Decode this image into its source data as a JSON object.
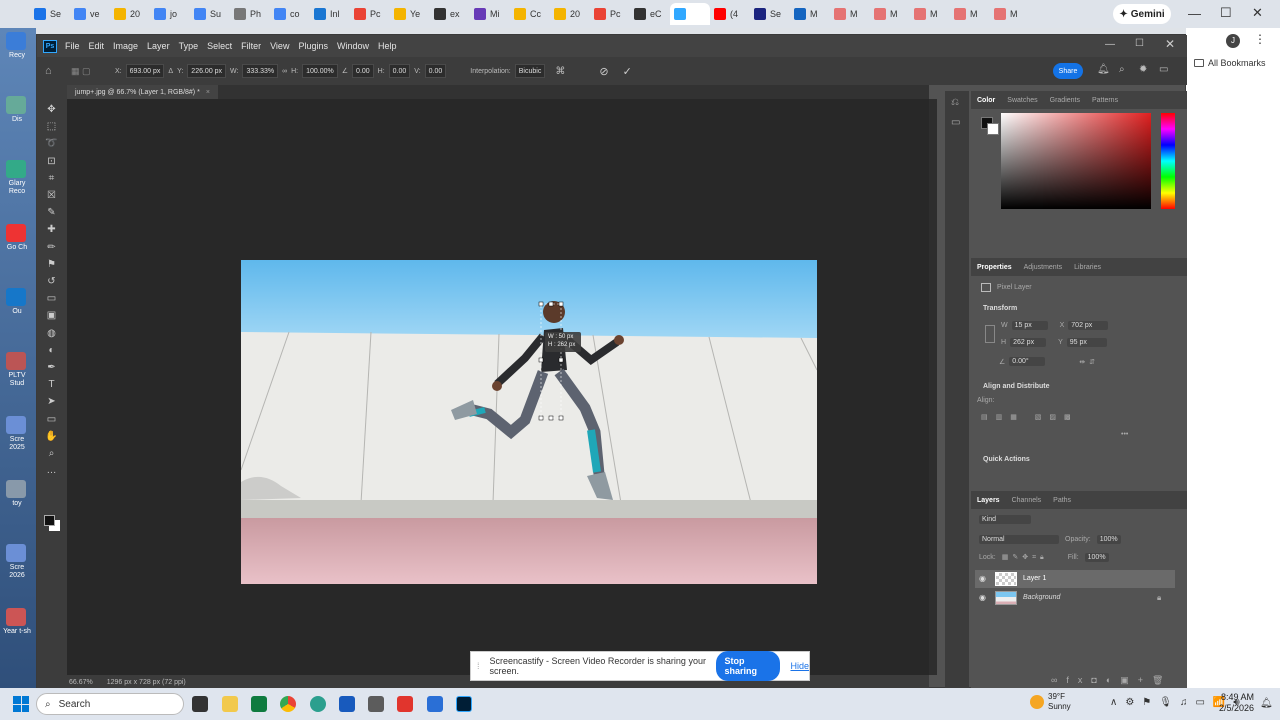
{
  "browser": {
    "tabs": [
      {
        "label": "Se",
        "color": "#1a73e8"
      },
      {
        "label": "ve",
        "color": "#4285f4"
      },
      {
        "label": "20",
        "color": "#f4b400"
      },
      {
        "label": "jo",
        "color": "#4285f4"
      },
      {
        "label": "Su",
        "color": "#4285f4"
      },
      {
        "label": "Ph",
        "color": "#777777"
      },
      {
        "label": "co",
        "color": "#4285f4"
      },
      {
        "label": "Inl",
        "color": "#1976d2"
      },
      {
        "label": "Pc",
        "color": "#ea4335"
      },
      {
        "label": "Ye",
        "color": "#f4b400"
      },
      {
        "label": "ex",
        "color": "#333333"
      },
      {
        "label": "Mi",
        "color": "#673ab7"
      },
      {
        "label": "Cc",
        "color": "#f4b400"
      },
      {
        "label": "20",
        "color": "#f4b400"
      },
      {
        "label": "Pc",
        "color": "#ea4335"
      },
      {
        "label": "eC",
        "color": "#333333"
      },
      {
        "label": "",
        "color": "#31a8ff"
      },
      {
        "label": "(4",
        "color": "#ff0000"
      },
      {
        "label": "Se",
        "color": "#1a237e"
      },
      {
        "label": "M",
        "color": "#1565c0"
      },
      {
        "label": "M",
        "color": "#e57373"
      },
      {
        "label": "M",
        "color": "#e57373"
      },
      {
        "label": "M",
        "color": "#e57373"
      },
      {
        "label": "M",
        "color": "#e57373"
      },
      {
        "label": "M",
        "color": "#e57373"
      }
    ],
    "gemini_label": "Gemini",
    "all_bookmarks": "All Bookmarks"
  },
  "ps": {
    "menu": [
      "File",
      "Edit",
      "Image",
      "Layer",
      "Type",
      "Select",
      "Filter",
      "View",
      "Plugins",
      "Window",
      "Help"
    ],
    "options": {
      "x_label": "X:",
      "x": "693.00 px",
      "y_label": "Y:",
      "y": "226.00 px",
      "w_label": "W:",
      "w": "333.33%",
      "h_label": "H:",
      "h": "100.00%",
      "angle": "0.00",
      "hskew_label": "H:",
      "hskew": "0.00",
      "vskew_label": "V:",
      "vskew": "0.00",
      "interp_label": "Interpolation:",
      "interp": "Bicubic"
    },
    "share_label": "Share",
    "doc_tab": "jump+.jpg @ 66.7% (Layer 1, RGB/8#) *",
    "status": {
      "zoom": "66.67%",
      "size": "1296 px x 728 px (72 ppi)"
    },
    "transform_tooltip": {
      "w": "W : 50 px",
      "h": "H : 262 px"
    },
    "color_panel": {
      "tabs": [
        "Color",
        "Swatches",
        "Gradients",
        "Patterns"
      ]
    },
    "properties": {
      "tabs": [
        "Properties",
        "Adjustments",
        "Libraries"
      ],
      "kind": "Pixel Layer",
      "transform_title": "Transform",
      "w_label": "W",
      "w": "15 px",
      "x_label": "X",
      "x": "702 px",
      "h_label": "H",
      "h": "262 px",
      "y_label": "Y",
      "y": "95 px",
      "angle": "0.00°",
      "align_title": "Align and Distribute",
      "align_label": "Align:",
      "quick_actions": "Quick Actions"
    },
    "layers": {
      "tabs": [
        "Layers",
        "Channels",
        "Paths"
      ],
      "filter": "Kind",
      "blend": "Normal",
      "opacity_label": "Opacity:",
      "opacity": "100%",
      "lock_label": "Lock:",
      "fill_label": "Fill:",
      "fill": "100%",
      "items": [
        {
          "name": "Layer 1"
        },
        {
          "name": "Background"
        }
      ]
    }
  },
  "screencastify": {
    "message": "Screencastify - Screen Video Recorder is sharing your screen.",
    "stop": "Stop sharing",
    "hide": "Hide"
  },
  "desktop": {
    "labels": [
      "Recy",
      "Dis",
      "Glary Reco",
      "Go Ch",
      "Ou",
      "PLTV Stud",
      "Scre 2025",
      "toy",
      "Scre 2026",
      "Year t-sh"
    ]
  },
  "taskbar": {
    "search": "Search",
    "weather_temp": "39°F",
    "weather_desc": "Sunny",
    "time": "8:49 AM",
    "date": "2/5/2026"
  }
}
